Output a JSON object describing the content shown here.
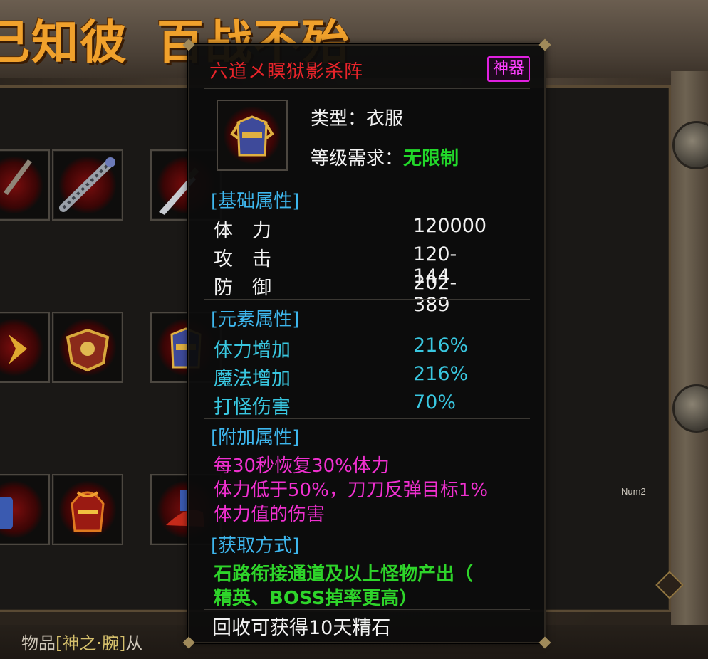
{
  "banner": {
    "left_text": "己知彼",
    "right_text": "百战不殆"
  },
  "inventory": {
    "num_label": "Num2",
    "slots": [
      {
        "icon": "spiked-mace-icon"
      },
      {
        "icon": "sword-icon"
      },
      {
        "icon": "golden-armor-icon"
      },
      {
        "icon": "armor-robe-icon"
      },
      {
        "icon": "demon-helmet-icon"
      },
      {
        "icon": "red-boots-icon"
      }
    ]
  },
  "chat": {
    "prefix": "物品",
    "item": "神之·腕",
    "bracket_open": "[",
    "bracket_close": "]",
    "suffix": "从"
  },
  "tooltip": {
    "title": "六道メ瞑狱影杀阵",
    "badge": "神器",
    "icon": "armor-robe-icon",
    "type_line": "类型：衣服",
    "level_label": "等级需求：",
    "level_value": "无限制",
    "base": {
      "header": "[基础属性]",
      "rows": [
        {
          "key": "体　力",
          "value": "120000"
        },
        {
          "key": "攻　击",
          "value": "120-144"
        },
        {
          "key": "防　御",
          "value": "202-389"
        }
      ]
    },
    "element": {
      "header": "[元素属性]",
      "rows": [
        {
          "key": "体力增加",
          "value": "216%"
        },
        {
          "key": "魔法增加",
          "value": "216%"
        },
        {
          "key": "打怪伤害",
          "value": "70%"
        }
      ]
    },
    "extra": {
      "header": "[附加属性]",
      "lines": [
        "每30秒恢复30%体力",
        "体力低于50%，刀刀反弹目标1%",
        "体力值的伤害"
      ]
    },
    "source": {
      "header": "[获取方式]",
      "lines": [
        "石路衔接通道及以上怪物产出（",
        "精英、BOSS掉率更高）"
      ]
    },
    "footer": "回收可获得10天精石"
  },
  "colors": {
    "title_red": "#e8242a",
    "badge_magenta": "#ff40ff",
    "section_blue": "#3eb7ee",
    "value_cyan": "#39c7e0",
    "extra_magenta": "#f030d0",
    "source_green": "#2ed42a"
  }
}
